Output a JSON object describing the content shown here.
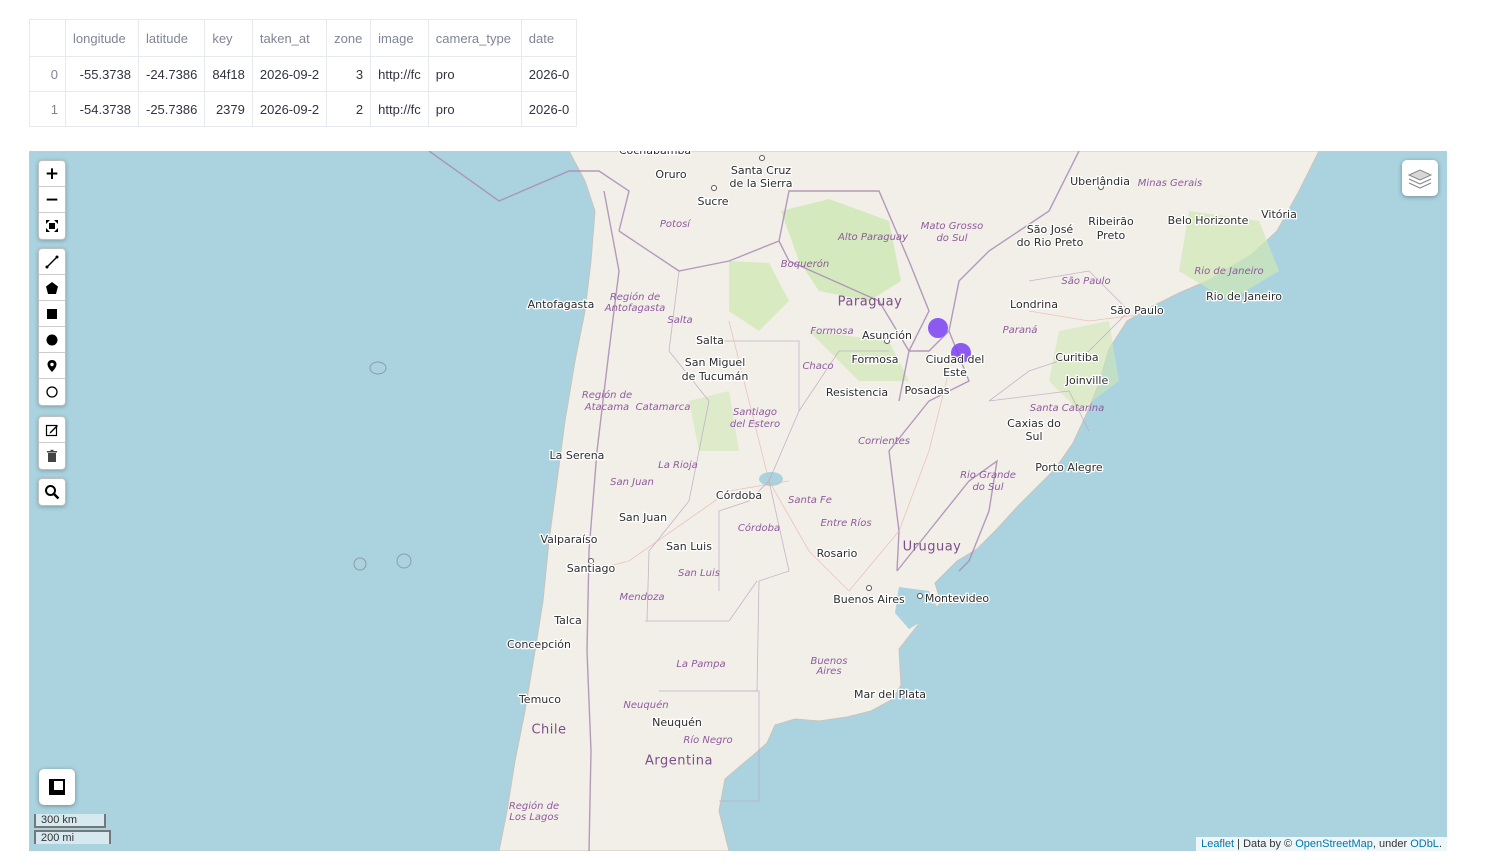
{
  "table": {
    "columns": [
      "",
      "longitude",
      "latitude",
      "key",
      "taken_at",
      "zone",
      "image",
      "camera_type",
      "date"
    ],
    "rows": [
      [
        "0",
        "-55.3738",
        "-24.7386",
        "84f18",
        "2026-09-2",
        "3",
        "http://fc",
        "pro",
        "2026-0"
      ],
      [
        "1",
        "-54.3738",
        "-25.7386",
        "2379",
        "2026-09-2",
        "2",
        "http://fc",
        "pro",
        "2026-0"
      ]
    ]
  },
  "map": {
    "labels": [
      {
        "text": "Cochabamba",
        "type": "city"
      },
      {
        "text": "Santa Cruz",
        "type": "city"
      },
      {
        "text": "de la Sierra",
        "type": "city"
      },
      {
        "text": "Oruro",
        "type": "city"
      },
      {
        "text": "Sucre",
        "type": "city"
      },
      {
        "text": "Potosí",
        "type": "region"
      },
      {
        "text": "Uberlândia",
        "type": "city"
      },
      {
        "text": "Minas Gerais",
        "type": "region"
      },
      {
        "text": "Vitória",
        "type": "city"
      },
      {
        "text": "Belo Horizonte",
        "type": "city"
      },
      {
        "text": "Mato Grosso",
        "type": "region"
      },
      {
        "text": "do Sul",
        "type": "region"
      },
      {
        "text": "São José",
        "type": "city"
      },
      {
        "text": "do Rio Preto",
        "type": "city"
      },
      {
        "text": "Ribeirão",
        "type": "city"
      },
      {
        "text": "Preto",
        "type": "city"
      },
      {
        "text": "Alto Paraguay",
        "type": "region"
      },
      {
        "text": "Boquerón",
        "type": "region"
      },
      {
        "text": "São Paulo",
        "type": "region"
      },
      {
        "text": "Rio de Janeiro",
        "type": "region"
      },
      {
        "text": "Rio de Janeiro",
        "type": "city"
      },
      {
        "text": "Paraguay",
        "type": "country"
      },
      {
        "text": "Londrina",
        "type": "city"
      },
      {
        "text": "São Paulo",
        "type": "city"
      },
      {
        "text": "Antofagasta",
        "type": "city"
      },
      {
        "text": "Región de",
        "type": "region"
      },
      {
        "text": "Antofagasta",
        "type": "region"
      },
      {
        "text": "Salta",
        "type": "region"
      },
      {
        "text": "Salta",
        "type": "city"
      },
      {
        "text": "Formosa",
        "type": "region"
      },
      {
        "text": "Asunción",
        "type": "city"
      },
      {
        "text": "Paraná",
        "type": "region"
      },
      {
        "text": "Curitiba",
        "type": "city"
      },
      {
        "text": "San Miguel",
        "type": "city"
      },
      {
        "text": "de Tucumán",
        "type": "city"
      },
      {
        "text": "Formosa",
        "type": "city"
      },
      {
        "text": "Ciudad del",
        "type": "city"
      },
      {
        "text": "Este",
        "type": "city"
      },
      {
        "text": "Chaco",
        "type": "region"
      },
      {
        "text": "Joinville",
        "type": "city"
      },
      {
        "text": "Resistencia",
        "type": "city"
      },
      {
        "text": "Posadas",
        "type": "city"
      },
      {
        "text": "Región de",
        "type": "region"
      },
      {
        "text": "Atacama",
        "type": "region"
      },
      {
        "text": "Catamarca",
        "type": "region"
      },
      {
        "text": "Santa Catarina",
        "type": "region"
      },
      {
        "text": "Santiago",
        "type": "region"
      },
      {
        "text": "del Estero",
        "type": "region"
      },
      {
        "text": "Caxias do",
        "type": "city"
      },
      {
        "text": "Sul",
        "type": "city"
      },
      {
        "text": "Corrientes",
        "type": "region"
      },
      {
        "text": "La Serena",
        "type": "city"
      },
      {
        "text": "La Rioja",
        "type": "region"
      },
      {
        "text": "Rio Grande",
        "type": "region"
      },
      {
        "text": "do Sul",
        "type": "region"
      },
      {
        "text": "Porto Alegre",
        "type": "city"
      },
      {
        "text": "San Juan",
        "type": "region"
      },
      {
        "text": "Córdoba",
        "type": "city"
      },
      {
        "text": "Santa Fe",
        "type": "region"
      },
      {
        "text": "San Juan",
        "type": "city"
      },
      {
        "text": "Entre Ríos",
        "type": "region"
      },
      {
        "text": "Córdoba",
        "type": "region"
      },
      {
        "text": "Valparaíso",
        "type": "city"
      },
      {
        "text": "Uruguay",
        "type": "country"
      },
      {
        "text": "San Luis",
        "type": "city"
      },
      {
        "text": "Santiago",
        "type": "city"
      },
      {
        "text": "Rosario",
        "type": "city"
      },
      {
        "text": "San Luis",
        "type": "region"
      },
      {
        "text": "Buenos Aires",
        "type": "city"
      },
      {
        "text": "Montevideo",
        "type": "city"
      },
      {
        "text": "Mendoza",
        "type": "region"
      },
      {
        "text": "Talca",
        "type": "city"
      },
      {
        "text": "Concepción",
        "type": "city"
      },
      {
        "text": "La Pampa",
        "type": "region"
      },
      {
        "text": "Buenos",
        "type": "region"
      },
      {
        "text": "Aires",
        "type": "region"
      },
      {
        "text": "Mar del Plata",
        "type": "city"
      },
      {
        "text": "Temuco",
        "type": "city"
      },
      {
        "text": "Neuquén",
        "type": "region"
      },
      {
        "text": "Chile",
        "type": "country"
      },
      {
        "text": "Neuquén",
        "type": "city"
      },
      {
        "text": "Río Negro",
        "type": "region"
      },
      {
        "text": "Argentina",
        "type": "country"
      },
      {
        "text": "Región de",
        "type": "region"
      },
      {
        "text": "Los Lagos",
        "type": "region"
      }
    ],
    "markers": [
      {
        "longitude": -55.3738,
        "latitude": -24.7386,
        "color": "#7b3ff2"
      },
      {
        "longitude": -54.3738,
        "latitude": -25.7386,
        "color": "#7b3ff2"
      }
    ],
    "controls": {
      "zoom_in": "+",
      "zoom_out": "−",
      "draw_tools": [
        "draw-polyline",
        "draw-polygon",
        "draw-rectangle",
        "draw-circle",
        "draw-marker",
        "draw-circlemarker"
      ],
      "edit_tools": [
        "edit-layers",
        "delete-layers"
      ],
      "search": "search-icon",
      "layers": "layers-icon",
      "fullscreen": "fullscreen-icon"
    },
    "scale": {
      "km": "300 km",
      "mi": "200 mi"
    },
    "attribution": {
      "leaflet": "Leaflet",
      "sep": " | Data by © ",
      "osm": "OpenStreetMap",
      "under": ", under ",
      "odbl": "ODbL",
      "end": "."
    },
    "colors": {
      "water": "#aad3df",
      "land": "#f2efe9",
      "green": "#c8e6a8",
      "border": "#9e7aa8",
      "marker": "#7b3ff2"
    }
  }
}
